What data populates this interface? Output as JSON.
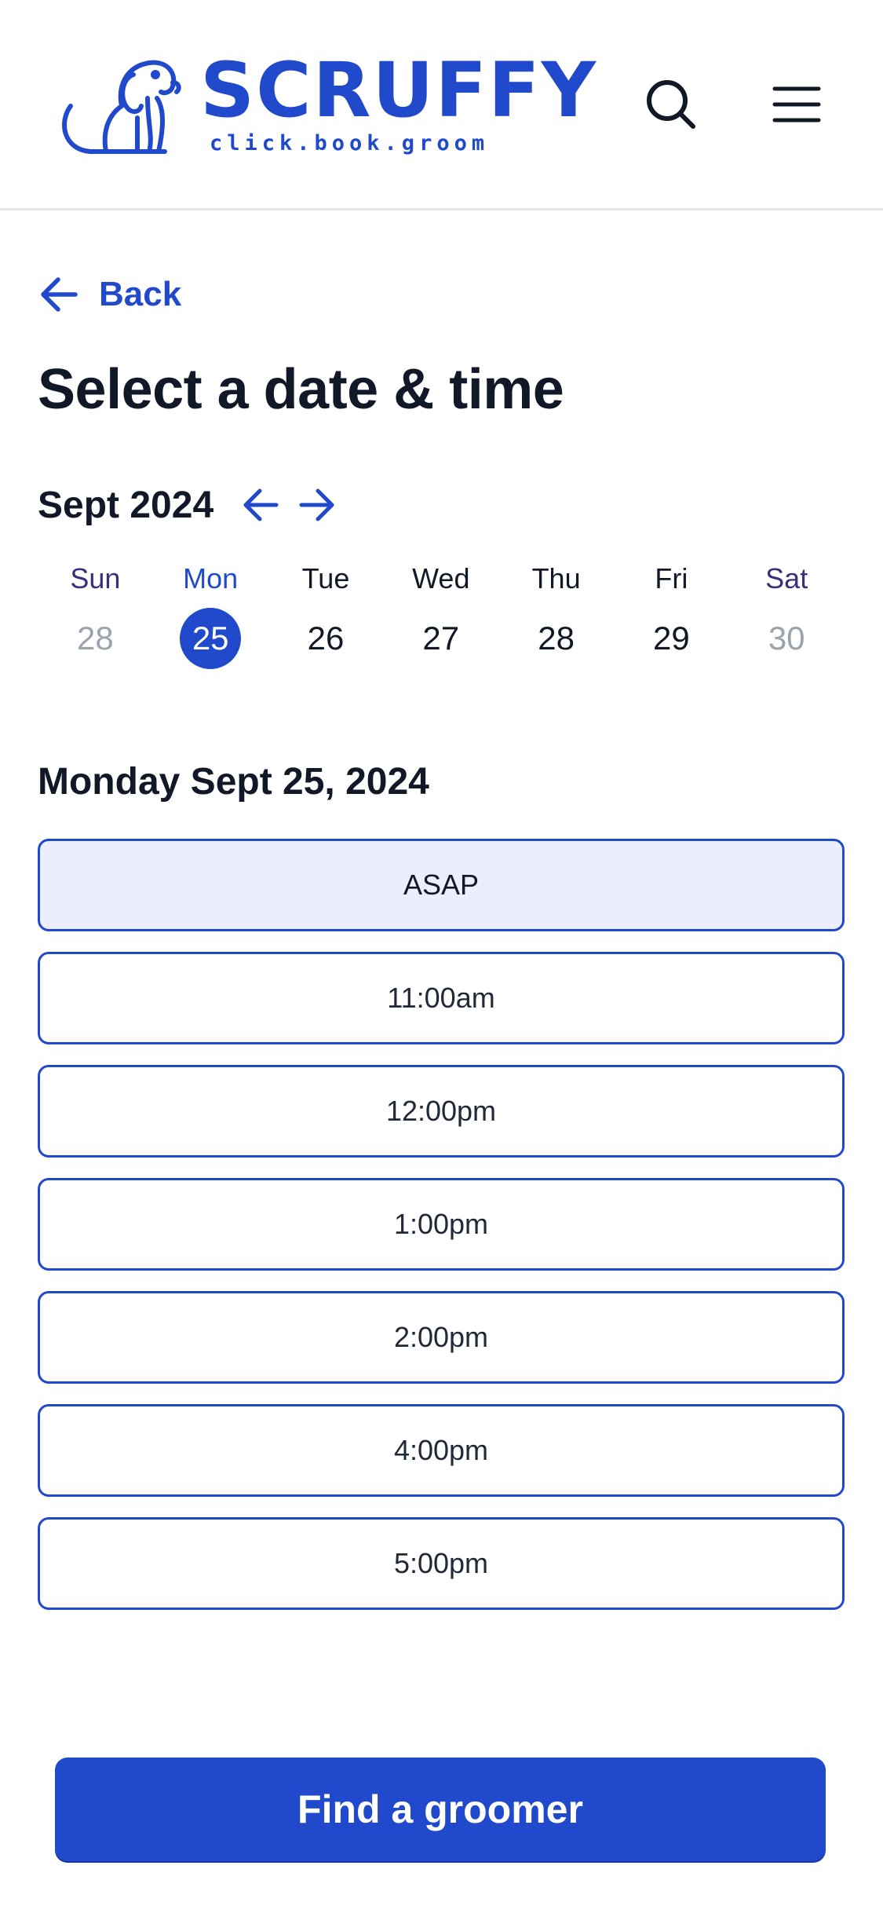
{
  "header": {
    "logo_word": "SCRUFFY",
    "logo_tagline": "click.book.groom",
    "icons": {
      "search": "search-icon",
      "menu": "hamburger-menu-icon",
      "logo": "dog-logo-icon"
    }
  },
  "back": {
    "label": "Back"
  },
  "page": {
    "title": "Select a date & time"
  },
  "calendar": {
    "month_label": "Sept 2024",
    "days": [
      {
        "name": "Sun",
        "num": "28",
        "state": "muted",
        "weekend": true
      },
      {
        "name": "Mon",
        "num": "25",
        "state": "selected",
        "weekend": false
      },
      {
        "name": "Tue",
        "num": "26",
        "state": "normal",
        "weekend": false
      },
      {
        "name": "Wed",
        "num": "27",
        "state": "normal",
        "weekend": false
      },
      {
        "name": "Thu",
        "num": "28",
        "state": "normal",
        "weekend": false
      },
      {
        "name": "Fri",
        "num": "29",
        "state": "normal",
        "weekend": false
      },
      {
        "name": "Sat",
        "num": "30",
        "state": "muted",
        "weekend": true
      }
    ]
  },
  "schedule": {
    "date_heading": "Monday Sept 25, 2024",
    "slots": [
      "ASAP",
      "11:00am",
      "12:00pm",
      "1:00pm",
      "2:00pm",
      "4:00pm",
      "5:00pm"
    ],
    "active_slot": "ASAP"
  },
  "cta": {
    "label": "Find a groomer"
  },
  "colors": {
    "accent": "#2149cc",
    "accent_light": "#eceffb",
    "text": "#111827",
    "muted": "#9ca3af",
    "weekend": "#3b2f7a"
  }
}
